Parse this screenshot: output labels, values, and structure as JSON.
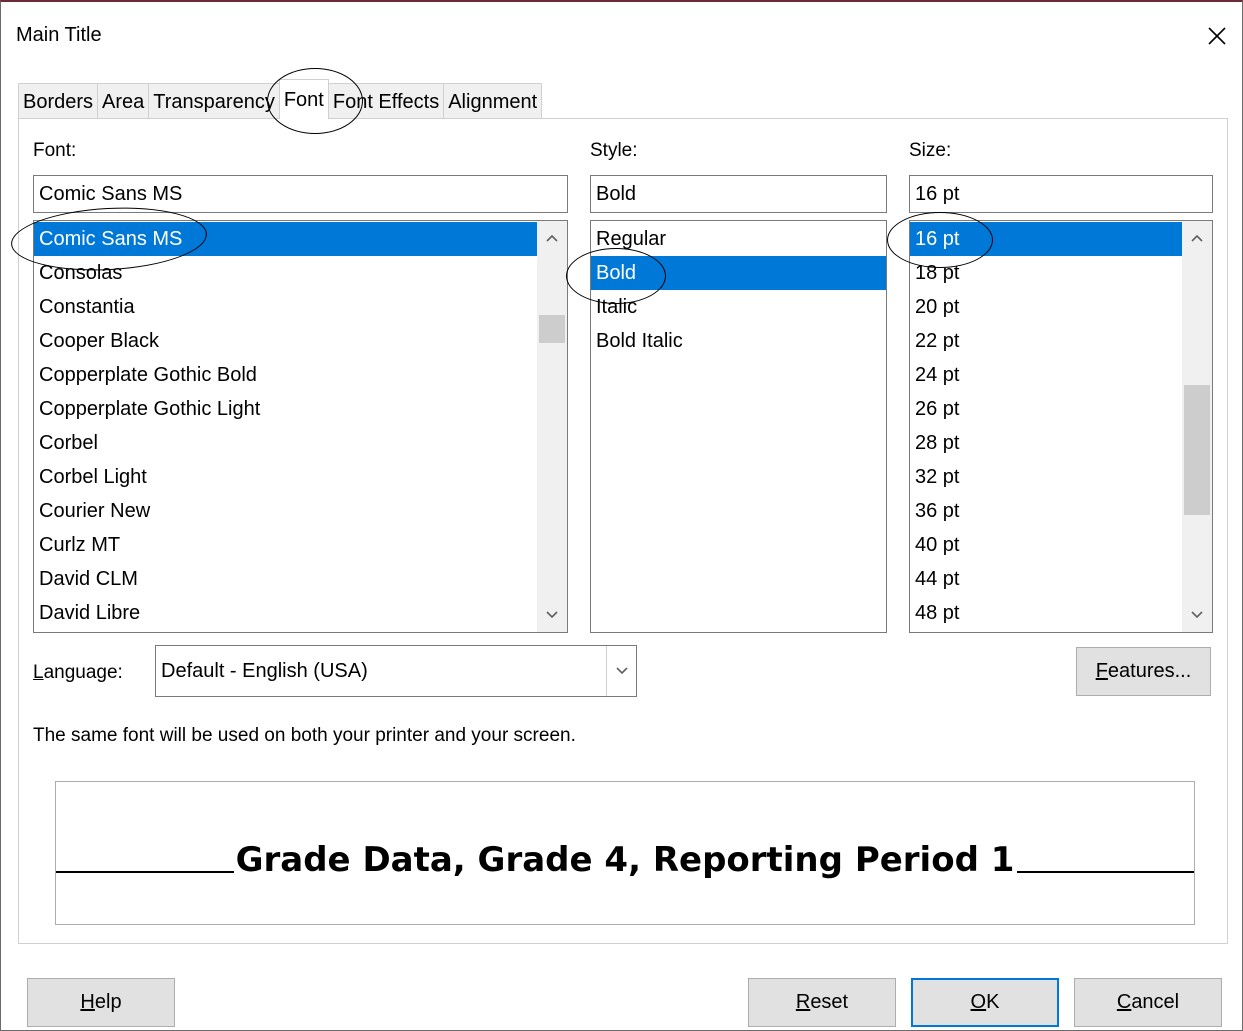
{
  "dialog": {
    "title": "Main Title",
    "close_icon": "close-icon"
  },
  "tabs": [
    {
      "label": "Borders",
      "active": false
    },
    {
      "label": "Area",
      "active": false
    },
    {
      "label": "Transparency",
      "active": false
    },
    {
      "label": "Font",
      "active": true
    },
    {
      "label": "Font Effects",
      "active": false
    },
    {
      "label": "Alignment",
      "active": false
    }
  ],
  "font": {
    "label": "Font:",
    "value": "Comic Sans MS",
    "items": [
      "Comic Sans MS",
      "Consolas",
      "Constantia",
      "Cooper Black",
      "Copperplate Gothic Bold",
      "Copperplate Gothic Light",
      "Corbel",
      "Corbel Light",
      "Courier New",
      "Curlz MT",
      "David CLM",
      "David Libre"
    ],
    "selected": "Comic Sans MS"
  },
  "style": {
    "label": "Style:",
    "value": "Bold",
    "items": [
      "Regular",
      "Bold",
      "Italic",
      "Bold Italic"
    ],
    "selected": "Bold"
  },
  "size": {
    "label": "Size:",
    "value": "16 pt",
    "items": [
      "16 pt",
      "18 pt",
      "20 pt",
      "22 pt",
      "24 pt",
      "26 pt",
      "28 pt",
      "32 pt",
      "36 pt",
      "40 pt",
      "44 pt",
      "48 pt"
    ],
    "selected": "16 pt"
  },
  "language": {
    "label_prefix": "",
    "label_underlined": "L",
    "label_rest": "anguage:",
    "value": "Default - English (USA)"
  },
  "features_button": {
    "underlined": "F",
    "rest": "eatures..."
  },
  "info_text": "The same font will be used on both your printer and your screen.",
  "preview_text": "Grade Data, Grade 4, Reporting Period 1",
  "buttons": {
    "help": {
      "underlined": "H",
      "rest": "elp"
    },
    "reset": {
      "underlined": "R",
      "rest": "eset"
    },
    "ok": {
      "underlined": "O",
      "rest": "K"
    },
    "cancel": {
      "underlined": "C",
      "rest": "ancel"
    }
  },
  "colors": {
    "selection": "#0078d7",
    "button_face": "#e1e1e1"
  }
}
